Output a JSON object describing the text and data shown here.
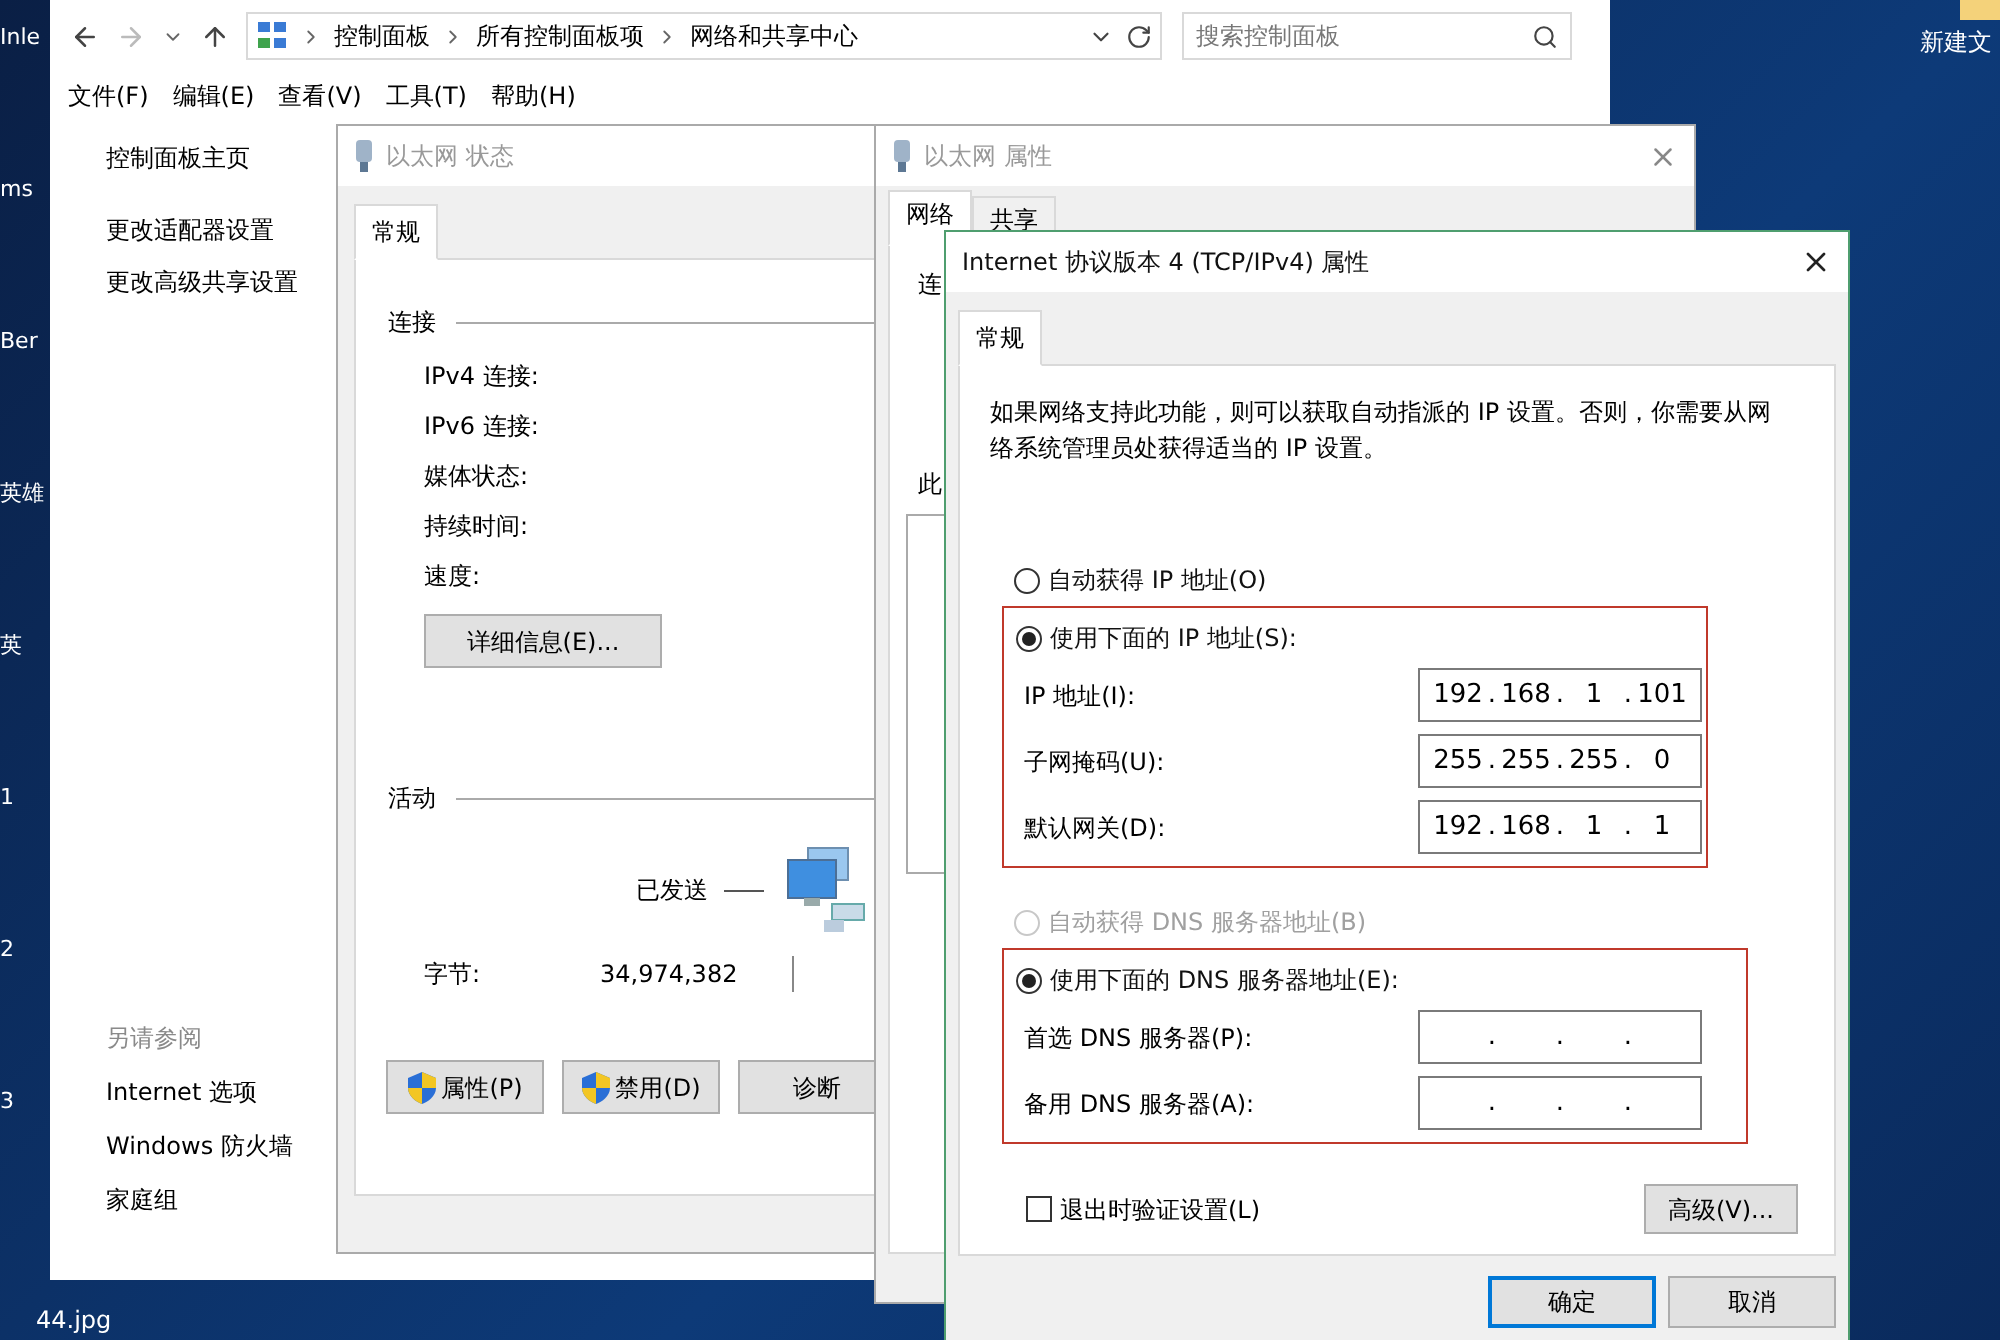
{
  "desktop": {
    "left_labels": [
      "Inle",
      "ms",
      "Ber",
      "英雄",
      "英",
      "1",
      "2",
      "3"
    ],
    "file_label": "44.jpg",
    "right_label": "新建文"
  },
  "explorer": {
    "breadcrumb": [
      "控制面板",
      "所有控制面板项",
      "网络和共享中心"
    ],
    "search": {
      "placeholder": "搜索控制面板"
    },
    "menu": [
      "文件(F)",
      "编辑(E)",
      "查看(V)",
      "工具(T)",
      "帮助(H)"
    ],
    "sidebar": {
      "links": [
        "控制面板主页",
        "更改适配器设置",
        "更改高级共享设置"
      ],
      "see_also_title": "另请参阅",
      "see_also": [
        "Internet 选项",
        "Windows 防火墙",
        "家庭组"
      ]
    }
  },
  "status_window": {
    "title": "以太网 状态",
    "tabs": [
      {
        "label": "常规",
        "selected": true
      }
    ],
    "connection": {
      "heading": "连接",
      "fields": [
        "IPv4 连接:",
        "IPv6 连接:",
        "媒体状态:",
        "持续时间:",
        "速度:"
      ],
      "details_button": "详细信息(E)..."
    },
    "activity": {
      "heading": "活动",
      "sent_label": "已发送",
      "bytes_label": "字节:",
      "bytes_sent": "34,974,382"
    },
    "buttons": [
      {
        "label": "属性(P)",
        "shield": true
      },
      {
        "label": "禁用(D)",
        "shield": true
      },
      {
        "label": "诊断",
        "shield": false
      }
    ]
  },
  "properties_window": {
    "title": "以太网 属性",
    "tabs": [
      {
        "label": "网络",
        "selected": true
      },
      {
        "label": "共享",
        "selected": false
      }
    ],
    "fragments": [
      "连",
      "此"
    ]
  },
  "tcp_dialog": {
    "title": "Internet 协议版本 4 (TCP/IPv4) 属性",
    "tabs": [
      {
        "label": "常规",
        "selected": true
      }
    ],
    "description": "如果网络支持此功能，则可以获取自动指派的 IP 设置。否则，你需要从网络系统管理员处获得适当的 IP 设置。",
    "octet_separator": ".",
    "ip_auto": {
      "label": "自动获得 IP 地址(O)",
      "selected": false,
      "disabled": false
    },
    "ip_manual": {
      "label": "使用下面的 IP 地址(S):",
      "selected": true,
      "disabled": false,
      "annotated": true,
      "fields": [
        {
          "label": "IP 地址(I):",
          "octets": [
            "192",
            "168",
            "1",
            "101"
          ]
        },
        {
          "label": "子网掩码(U):",
          "octets": [
            "255",
            "255",
            "255",
            "0"
          ]
        },
        {
          "label": "默认网关(D):",
          "octets": [
            "192",
            "168",
            "1",
            "1"
          ]
        }
      ]
    },
    "dns_auto": {
      "label": "自动获得 DNS 服务器地址(B)",
      "selected": false,
      "disabled": true
    },
    "dns_manual": {
      "label": "使用下面的 DNS 服务器地址(E):",
      "selected": true,
      "disabled": false,
      "annotated": true,
      "fields": [
        {
          "label": "首选 DNS 服务器(P):"
        },
        {
          "label": "备用 DNS 服务器(A):"
        }
      ]
    },
    "validate_on_exit": {
      "label": "退出时验证设置(L)",
      "checked": false
    },
    "advanced_button": "高级(V)...",
    "buttons": [
      {
        "label": "确定",
        "default": true
      },
      {
        "label": "取消",
        "default": false
      }
    ]
  }
}
